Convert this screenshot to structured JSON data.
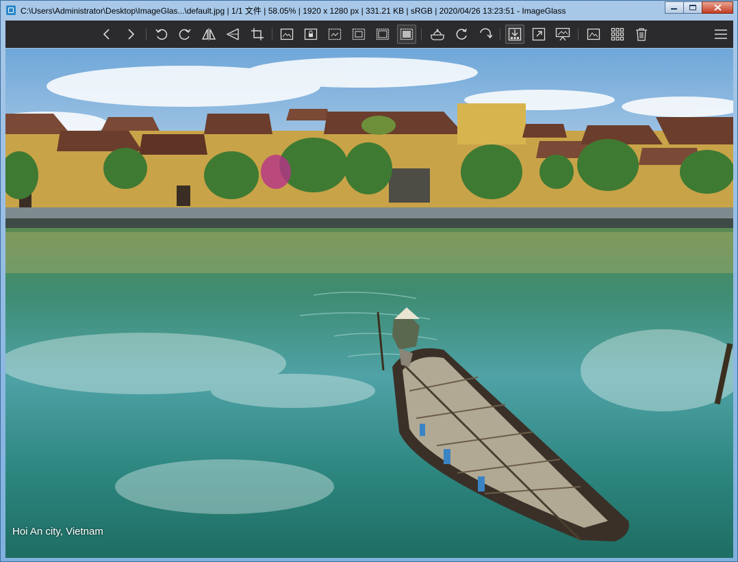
{
  "window": {
    "title": "C:\\Users\\Administrator\\Desktop\\ImageGlas...\\default.jpg  |  1/1 文件  |  58.05%  |  1920 x 1280 px  |  331.21 KB  |  sRGB  |  2020/04/26 13:23:51  - ImageGlass",
    "buttons": [
      "minimize",
      "maximize",
      "close"
    ]
  },
  "toolbar": {
    "items": [
      {
        "icon": "previous-image-icon"
      },
      {
        "icon": "next-image-icon"
      },
      {
        "icon": "rotate-left-icon"
      },
      {
        "icon": "rotate-right-icon"
      },
      {
        "icon": "flip-horizontal-icon"
      },
      {
        "icon": "flip-vertical-icon"
      },
      {
        "icon": "crop-icon"
      },
      {
        "icon": "auto-zoom-icon"
      },
      {
        "icon": "lock-zoom-icon"
      },
      {
        "icon": "scale-to-width-icon"
      },
      {
        "icon": "scale-to-height-icon"
      },
      {
        "icon": "scale-to-fit-icon"
      },
      {
        "icon": "scale-to-fill-icon",
        "active": true
      },
      {
        "icon": "checkerboard-icon"
      },
      {
        "icon": "refresh-icon"
      },
      {
        "icon": "go-to-image-icon"
      },
      {
        "icon": "thumbnail-bar-icon",
        "active": true
      },
      {
        "icon": "fullscreen-icon"
      },
      {
        "icon": "slideshow-icon"
      },
      {
        "icon": "set-wallpaper-icon"
      },
      {
        "icon": "gallery-grid-icon"
      },
      {
        "icon": "delete-icon"
      },
      {
        "icon": "main-menu-icon"
      }
    ]
  },
  "viewer": {
    "image_caption": "Hoi An city, Vietnam",
    "colors": {
      "sky": "#a9cbe8",
      "water": "#2f8a86",
      "toolbar": "#2b2b2d"
    }
  }
}
